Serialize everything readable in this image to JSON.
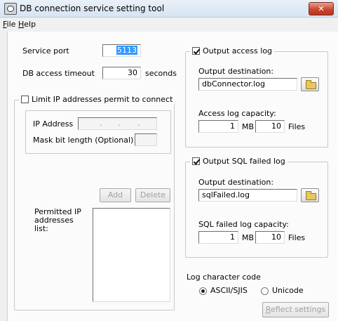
{
  "window": {
    "title": "DB connection service setting tool",
    "close_glyph": "✕"
  },
  "menu": {
    "file": {
      "mnemonic": "F",
      "rest": "ile"
    },
    "help": {
      "mnemonic": "H",
      "rest": "elp"
    }
  },
  "service": {
    "port_label": "Service port",
    "port_value": "5113",
    "timeout_label": "DB access timeout",
    "timeout_value": "30",
    "timeout_unit": "seconds"
  },
  "ip_limit": {
    "checkbox_label": "Limit IP addresses permit to connect",
    "checked": false,
    "ip_label": "IP Address",
    "ip_dot": ".",
    "mask_label": "Mask bit length (Optional)",
    "add_label": "Add",
    "delete_label": "Delete",
    "permitted_label": "Permitted IP addresses list:"
  },
  "access_log": {
    "checkbox_label": "Output access log",
    "checked": true,
    "dest_label": "Output destination:",
    "dest_value": "dbConnector.log",
    "capacity_label": "Access log capacity:",
    "mb_value": "1",
    "mb_unit": "MB x",
    "files_value": "10",
    "files_unit": "Files"
  },
  "sql_log": {
    "checkbox_label": "Output SQL failed log",
    "checked": true,
    "dest_label": "Output destination:",
    "dest_value": "sqlFailed.log",
    "capacity_label": "SQL failed log capacity:",
    "mb_value": "1",
    "mb_unit": "MB x",
    "files_value": "10",
    "files_unit": "Files"
  },
  "charset": {
    "label": "Log character code",
    "options": [
      {
        "label": "ASCII/SJIS",
        "selected": true
      },
      {
        "label": "Unicode",
        "selected": false
      }
    ]
  },
  "reflect": {
    "mnemonic": "R",
    "rest": "eflect settings"
  },
  "icons": {
    "app": "app-icon",
    "close": "close-icon",
    "folder_access": "folder-icon",
    "folder_sql": "folder-icon"
  },
  "colors": {
    "selection": "#3399ff",
    "close_button": "#c9472f",
    "titlebar": "#d7e4f2"
  }
}
